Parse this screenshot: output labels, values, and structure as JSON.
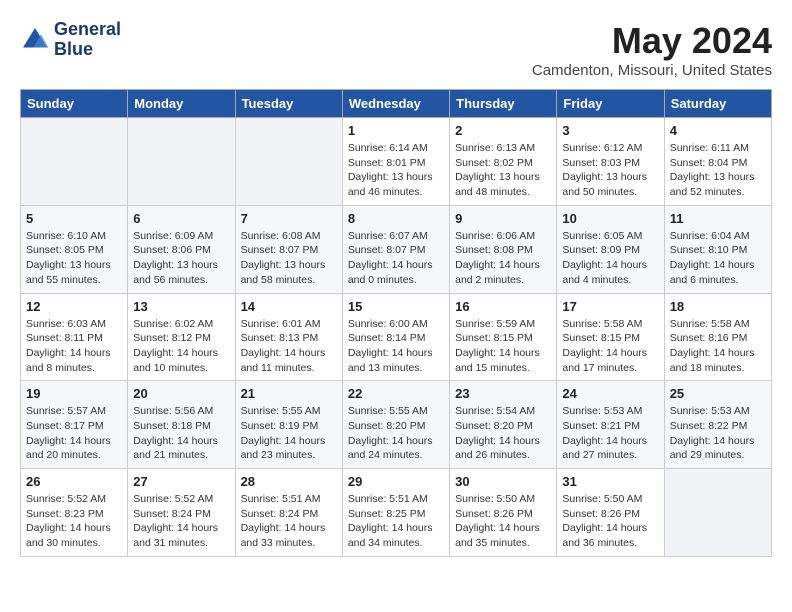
{
  "header": {
    "logo_line1": "General",
    "logo_line2": "Blue",
    "month": "May 2024",
    "location": "Camdenton, Missouri, United States"
  },
  "weekdays": [
    "Sunday",
    "Monday",
    "Tuesday",
    "Wednesday",
    "Thursday",
    "Friday",
    "Saturday"
  ],
  "weeks": [
    [
      {
        "day": "",
        "sunrise": "",
        "sunset": "",
        "daylight": ""
      },
      {
        "day": "",
        "sunrise": "",
        "sunset": "",
        "daylight": ""
      },
      {
        "day": "",
        "sunrise": "",
        "sunset": "",
        "daylight": ""
      },
      {
        "day": "1",
        "sunrise": "6:14 AM",
        "sunset": "8:01 PM",
        "daylight": "13 hours and 46 minutes."
      },
      {
        "day": "2",
        "sunrise": "6:13 AM",
        "sunset": "8:02 PM",
        "daylight": "13 hours and 48 minutes."
      },
      {
        "day": "3",
        "sunrise": "6:12 AM",
        "sunset": "8:03 PM",
        "daylight": "13 hours and 50 minutes."
      },
      {
        "day": "4",
        "sunrise": "6:11 AM",
        "sunset": "8:04 PM",
        "daylight": "13 hours and 52 minutes."
      }
    ],
    [
      {
        "day": "5",
        "sunrise": "6:10 AM",
        "sunset": "8:05 PM",
        "daylight": "13 hours and 55 minutes."
      },
      {
        "day": "6",
        "sunrise": "6:09 AM",
        "sunset": "8:06 PM",
        "daylight": "13 hours and 56 minutes."
      },
      {
        "day": "7",
        "sunrise": "6:08 AM",
        "sunset": "8:07 PM",
        "daylight": "13 hours and 58 minutes."
      },
      {
        "day": "8",
        "sunrise": "6:07 AM",
        "sunset": "8:07 PM",
        "daylight": "14 hours and 0 minutes."
      },
      {
        "day": "9",
        "sunrise": "6:06 AM",
        "sunset": "8:08 PM",
        "daylight": "14 hours and 2 minutes."
      },
      {
        "day": "10",
        "sunrise": "6:05 AM",
        "sunset": "8:09 PM",
        "daylight": "14 hours and 4 minutes."
      },
      {
        "day": "11",
        "sunrise": "6:04 AM",
        "sunset": "8:10 PM",
        "daylight": "14 hours and 6 minutes."
      }
    ],
    [
      {
        "day": "12",
        "sunrise": "6:03 AM",
        "sunset": "8:11 PM",
        "daylight": "14 hours and 8 minutes."
      },
      {
        "day": "13",
        "sunrise": "6:02 AM",
        "sunset": "8:12 PM",
        "daylight": "14 hours and 10 minutes."
      },
      {
        "day": "14",
        "sunrise": "6:01 AM",
        "sunset": "8:13 PM",
        "daylight": "14 hours and 11 minutes."
      },
      {
        "day": "15",
        "sunrise": "6:00 AM",
        "sunset": "8:14 PM",
        "daylight": "14 hours and 13 minutes."
      },
      {
        "day": "16",
        "sunrise": "5:59 AM",
        "sunset": "8:15 PM",
        "daylight": "14 hours and 15 minutes."
      },
      {
        "day": "17",
        "sunrise": "5:58 AM",
        "sunset": "8:15 PM",
        "daylight": "14 hours and 17 minutes."
      },
      {
        "day": "18",
        "sunrise": "5:58 AM",
        "sunset": "8:16 PM",
        "daylight": "14 hours and 18 minutes."
      }
    ],
    [
      {
        "day": "19",
        "sunrise": "5:57 AM",
        "sunset": "8:17 PM",
        "daylight": "14 hours and 20 minutes."
      },
      {
        "day": "20",
        "sunrise": "5:56 AM",
        "sunset": "8:18 PM",
        "daylight": "14 hours and 21 minutes."
      },
      {
        "day": "21",
        "sunrise": "5:55 AM",
        "sunset": "8:19 PM",
        "daylight": "14 hours and 23 minutes."
      },
      {
        "day": "22",
        "sunrise": "5:55 AM",
        "sunset": "8:20 PM",
        "daylight": "14 hours and 24 minutes."
      },
      {
        "day": "23",
        "sunrise": "5:54 AM",
        "sunset": "8:20 PM",
        "daylight": "14 hours and 26 minutes."
      },
      {
        "day": "24",
        "sunrise": "5:53 AM",
        "sunset": "8:21 PM",
        "daylight": "14 hours and 27 minutes."
      },
      {
        "day": "25",
        "sunrise": "5:53 AM",
        "sunset": "8:22 PM",
        "daylight": "14 hours and 29 minutes."
      }
    ],
    [
      {
        "day": "26",
        "sunrise": "5:52 AM",
        "sunset": "8:23 PM",
        "daylight": "14 hours and 30 minutes."
      },
      {
        "day": "27",
        "sunrise": "5:52 AM",
        "sunset": "8:24 PM",
        "daylight": "14 hours and 31 minutes."
      },
      {
        "day": "28",
        "sunrise": "5:51 AM",
        "sunset": "8:24 PM",
        "daylight": "14 hours and 33 minutes."
      },
      {
        "day": "29",
        "sunrise": "5:51 AM",
        "sunset": "8:25 PM",
        "daylight": "14 hours and 34 minutes."
      },
      {
        "day": "30",
        "sunrise": "5:50 AM",
        "sunset": "8:26 PM",
        "daylight": "14 hours and 35 minutes."
      },
      {
        "day": "31",
        "sunrise": "5:50 AM",
        "sunset": "8:26 PM",
        "daylight": "14 hours and 36 minutes."
      },
      {
        "day": "",
        "sunrise": "",
        "sunset": "",
        "daylight": ""
      }
    ]
  ]
}
